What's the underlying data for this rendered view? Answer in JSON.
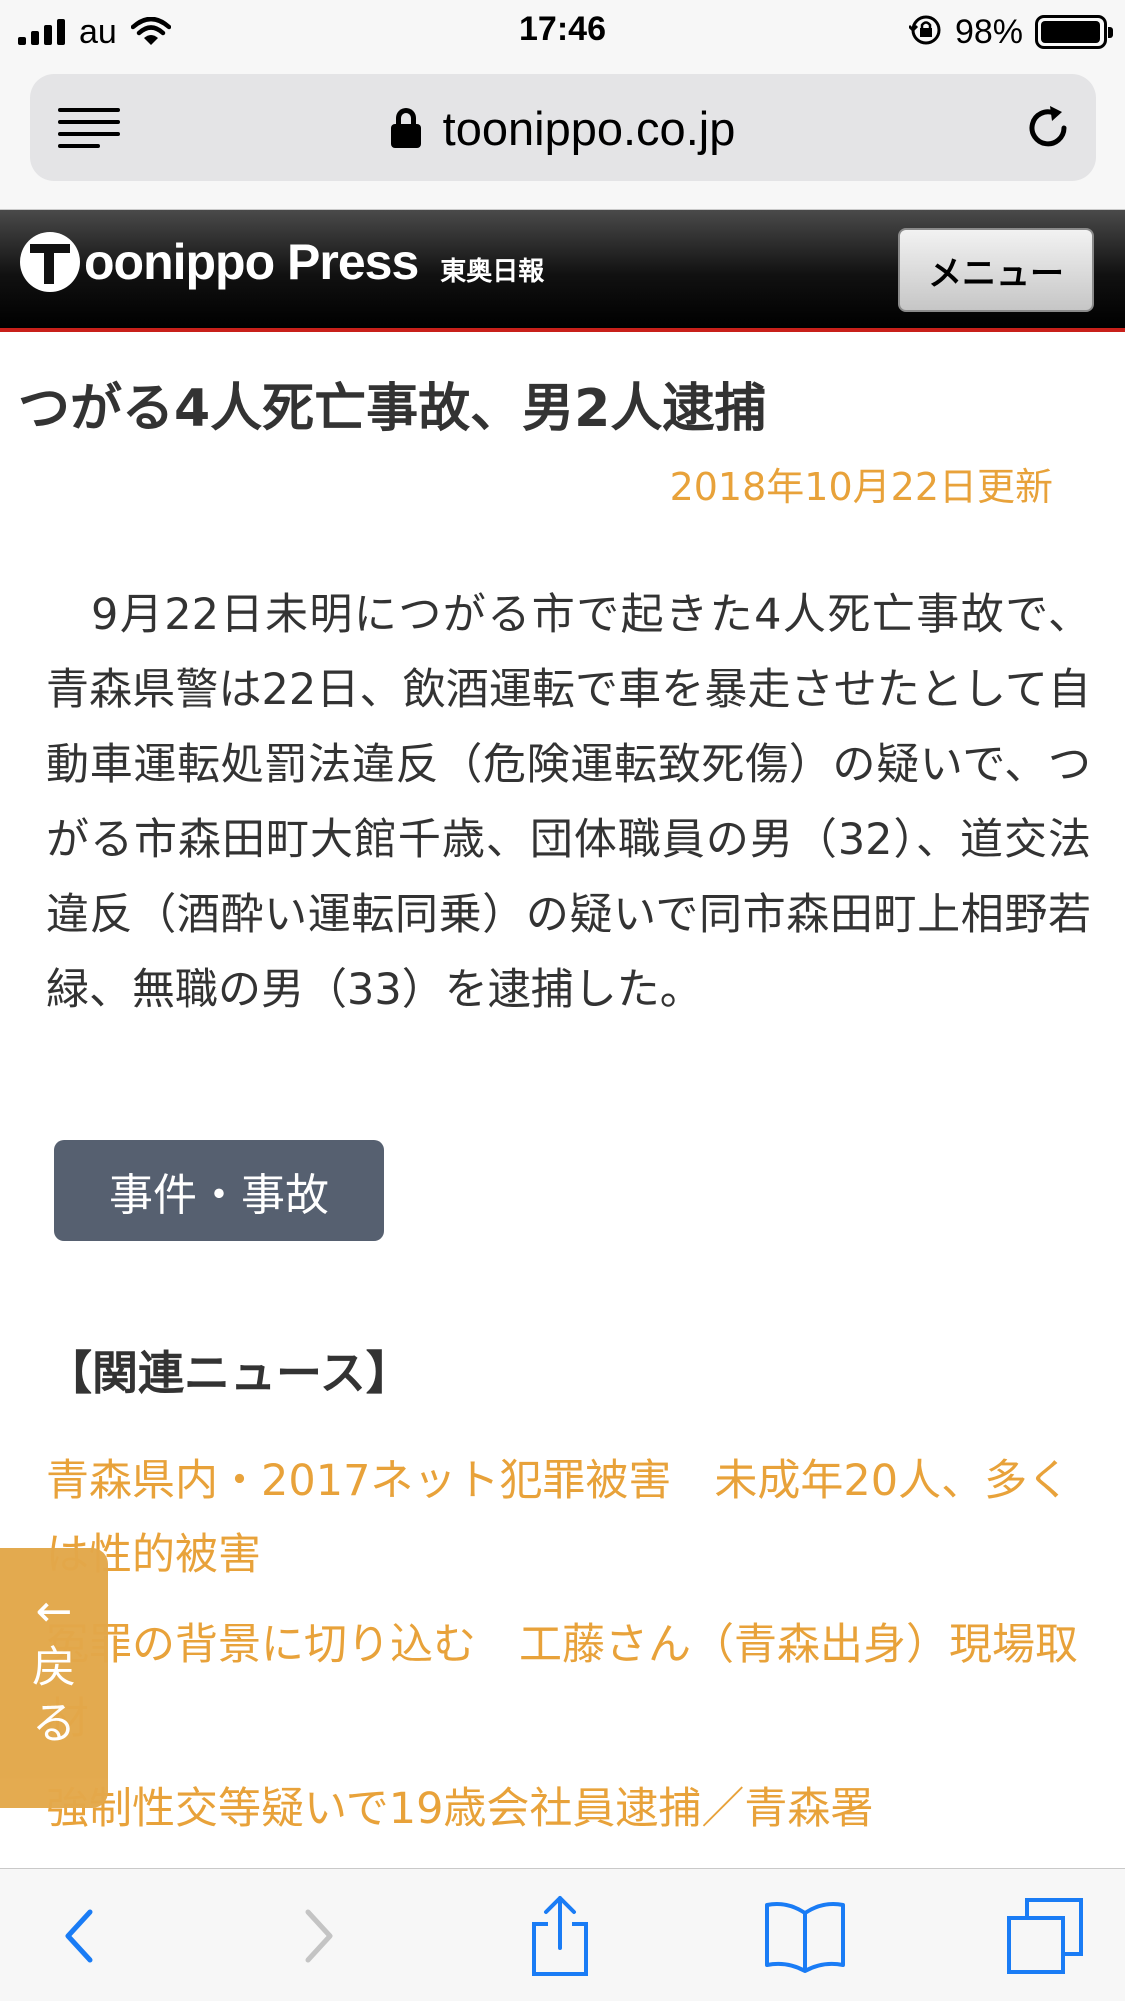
{
  "status_bar": {
    "carrier": "au",
    "time": "17:46",
    "battery_percent": "98%",
    "battery_level": 0.98
  },
  "browser": {
    "url": "toonippo.co.jp",
    "icons": [
      "reader-icon",
      "lock-icon",
      "reload-icon"
    ]
  },
  "site": {
    "logo_text": "oonippo Press",
    "logo_sub": "東奥日報",
    "menu_label": "メニュー"
  },
  "article": {
    "title": "つがる4人死亡事故、男2人逮捕",
    "date": "2018年10月22日更新",
    "body": "9月22日未明につがる市で起きた4人死亡事故で、青森県警は22日、飲酒運転で車を暴走させたとして自動車運転処罰法違反（危険運転致死傷）の疑いで、つがる市森田町大館千歳、団体職員の男（32）、道交法違反（酒酔い運転同乗）の疑いで同市森田町上相野若緑、無職の男（33）を逮捕した。",
    "category": "事件・事故"
  },
  "related": {
    "heading": "【関連ニュース】",
    "items": [
      "青森県内・2017ネット犯罪被害　未成年20人、多くは性的被害",
      "冤罪の背景に切り込む　工藤さん（青森出身）現場取材",
      "強制性交等疑いで19歳会社員逮捕／青森署"
    ]
  },
  "back_tab": {
    "arrow": "←",
    "label_1": "戻",
    "label_2": "る"
  },
  "toolbar": {
    "icons": [
      "back-icon",
      "forward-icon",
      "share-icon",
      "bookmarks-icon",
      "tabs-icon"
    ],
    "accent_color": "#1a7cf5",
    "disabled_color": "#c4c4c4"
  },
  "colors": {
    "link": "#e8a23a",
    "header_rule": "#c8201a",
    "tag_bg": "#566070"
  }
}
